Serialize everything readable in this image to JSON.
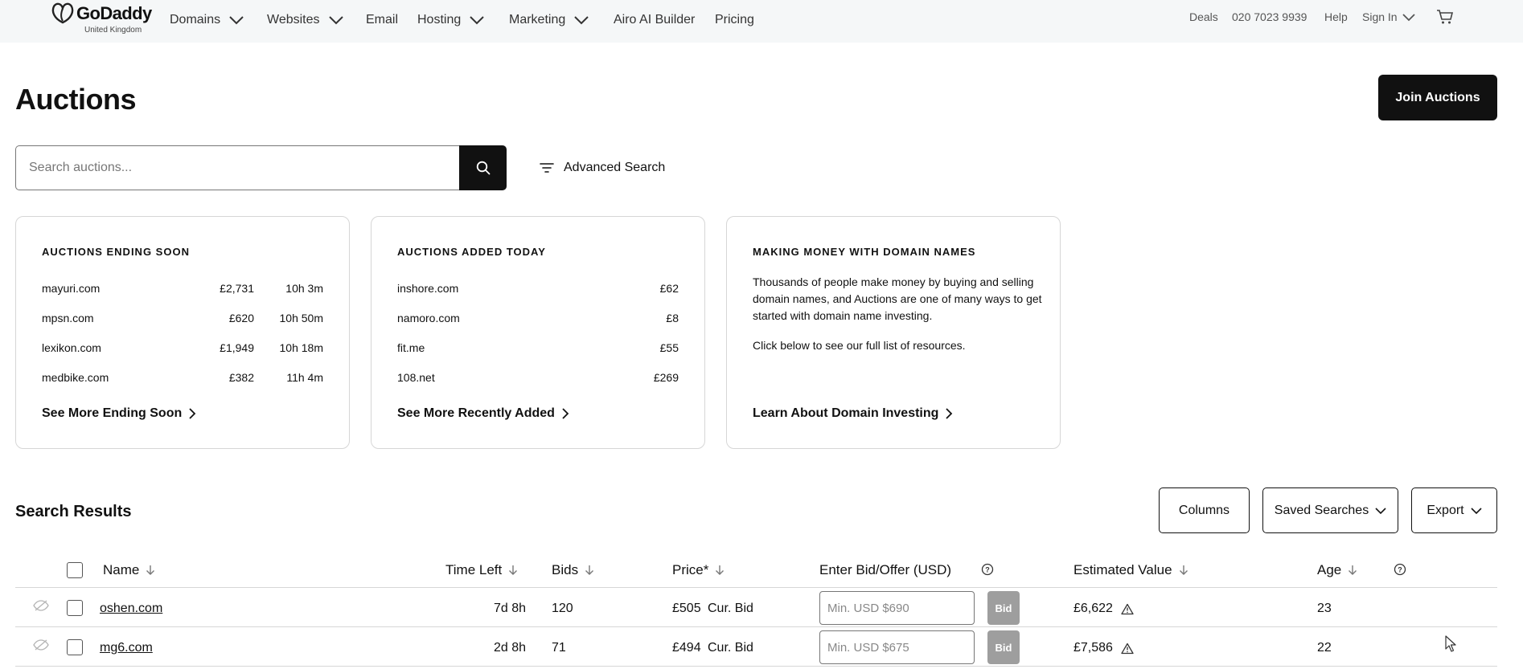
{
  "brand": {
    "name": "GoDaddy",
    "region": "United Kingdom"
  },
  "nav": {
    "items": [
      {
        "label": "Domains",
        "dropdown": true
      },
      {
        "label": "Websites",
        "dropdown": true
      },
      {
        "label": "Email",
        "dropdown": false
      },
      {
        "label": "Hosting",
        "dropdown": true
      },
      {
        "label": "Marketing",
        "dropdown": true
      },
      {
        "label": "Airo AI Builder",
        "dropdown": false
      },
      {
        "label": "Pricing",
        "dropdown": false
      }
    ],
    "right": {
      "deals": "Deals",
      "phone": "020 7023 9939",
      "help": "Help",
      "sign_in": "Sign In"
    }
  },
  "page": {
    "title": "Auctions",
    "join_button": "Join Auctions"
  },
  "search": {
    "placeholder": "Search auctions...",
    "advanced_label": "Advanced Search"
  },
  "cards": {
    "ending_soon": {
      "title": "AUCTIONS ENDING SOON",
      "rows": [
        {
          "name": "mayuri.com",
          "price": "£2,731",
          "time": "10h 3m"
        },
        {
          "name": "mpsn.com",
          "price": "£620",
          "time": "10h 50m"
        },
        {
          "name": "lexikon.com",
          "price": "£1,949",
          "time": "10h 18m"
        },
        {
          "name": "medbike.com",
          "price": "£382",
          "time": "11h 4m"
        }
      ],
      "link": "See More Ending Soon"
    },
    "added_today": {
      "title": "AUCTIONS ADDED TODAY",
      "rows": [
        {
          "name": "inshore.com",
          "price": "£62"
        },
        {
          "name": "namoro.com",
          "price": "£8"
        },
        {
          "name": "fit.me",
          "price": "£55"
        },
        {
          "name": "108.net",
          "price": "£269"
        }
      ],
      "link": "See More Recently Added"
    },
    "money": {
      "title": "MAKING MONEY WITH DOMAIN NAMES",
      "paragraph1": "Thousands of people make money by buying and selling domain names, and Auctions are one of many ways to get started with domain name investing.",
      "paragraph2": "Click below to see our full list of resources.",
      "link": "Learn About Domain Investing"
    }
  },
  "results": {
    "title": "Search Results",
    "controls": {
      "columns": "Columns",
      "saved_searches": "Saved Searches",
      "export": "Export"
    },
    "headers": {
      "name": "Name",
      "time_left": "Time Left",
      "bids": "Bids",
      "price": "Price*",
      "bid_offer": "Enter Bid/Offer (USD)",
      "estimated_value": "Estimated Value",
      "age": "Age"
    },
    "rows": [
      {
        "name": "oshen.com",
        "time_left": "7d 8h",
        "bids": "120",
        "price": "£505",
        "price_type": "Cur. Bid",
        "bid_placeholder": "Min. USD $690",
        "bid_button": "Bid",
        "estimated_value": "£6,622",
        "age": "23"
      },
      {
        "name": "mg6.com",
        "time_left": "2d 8h",
        "bids": "71",
        "price": "£494",
        "price_type": "Cur. Bid",
        "bid_placeholder": "Min. USD $675",
        "bid_button": "Bid",
        "estimated_value": "£7,586",
        "age": "22"
      }
    ]
  }
}
